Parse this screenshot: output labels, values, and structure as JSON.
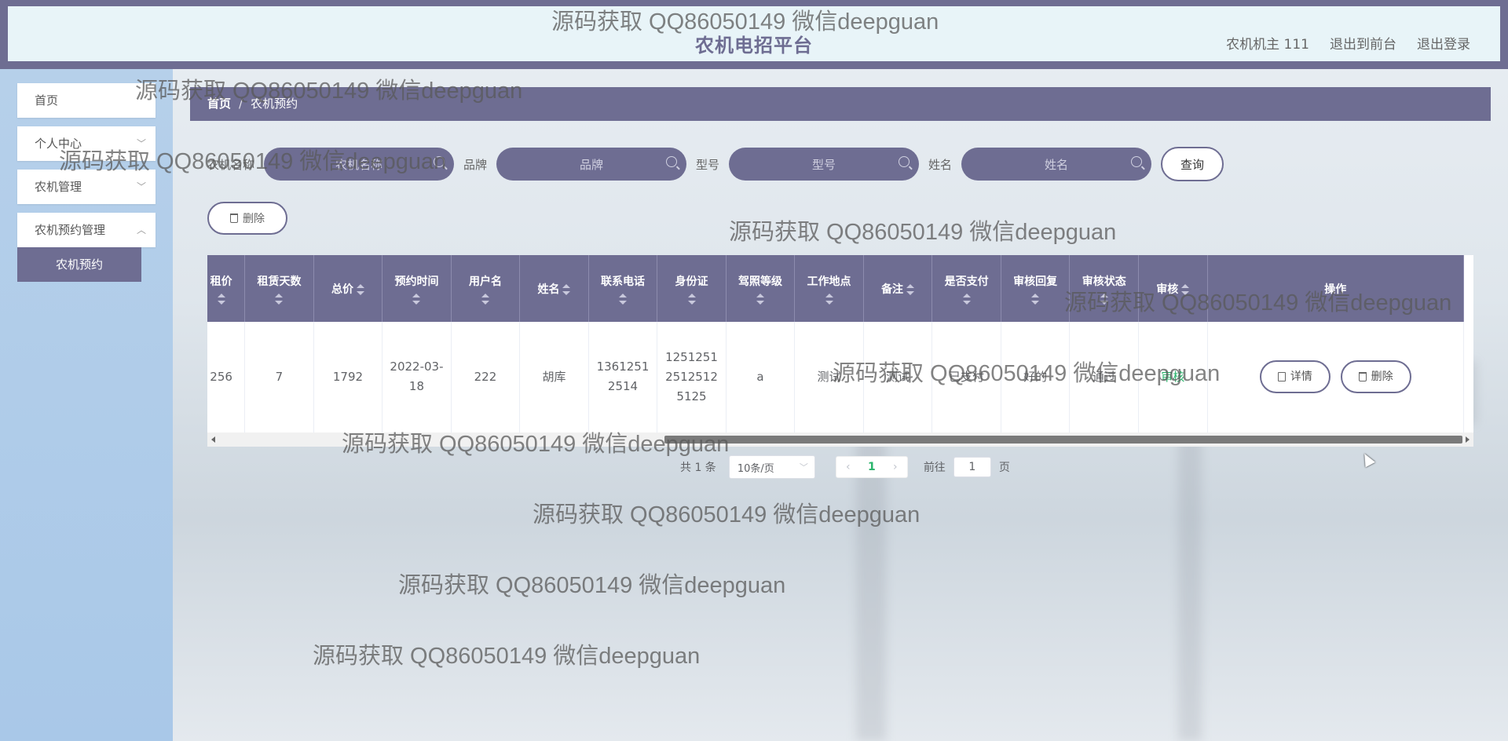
{
  "header": {
    "site_title": "农机电招平台",
    "user_label": "农机机主 111",
    "back_to_front": "退出到前台",
    "logout": "退出登录"
  },
  "sidebar": {
    "items": [
      {
        "label": "首页"
      },
      {
        "label": "个人中心"
      },
      {
        "label": "农机管理"
      },
      {
        "label": "农机预约管理"
      }
    ],
    "active_sub": "农机预约"
  },
  "breadcrumb": {
    "home": "首页",
    "sep": "/",
    "current": "农机预约"
  },
  "search": {
    "fields": [
      {
        "label": "农机名称",
        "placeholder": "农机名称"
      },
      {
        "label": "品牌",
        "placeholder": "品牌"
      },
      {
        "label": "型号",
        "placeholder": "型号"
      },
      {
        "label": "姓名",
        "placeholder": "姓名"
      }
    ],
    "query_button": "查询"
  },
  "toolbar": {
    "delete_label": "删除"
  },
  "table": {
    "columns": [
      "租价",
      "租赁天数",
      "总价",
      "预约时间",
      "用户名",
      "姓名",
      "联系电话",
      "身份证",
      "驾照等级",
      "工作地点",
      "备注",
      "是否支付",
      "审核回复",
      "审核状态",
      "审核",
      "操作"
    ],
    "rows": [
      {
        "cells": [
          "256",
          "7",
          "1792",
          "2022-03-18",
          "222",
          "胡库",
          "13612512514",
          "125125125125125125",
          "a",
          "测试",
          "测试",
          "已支付",
          "好的",
          "通过",
          "审核"
        ],
        "detail_label": "详情",
        "delete_label": "删除"
      }
    ]
  },
  "pagination": {
    "total": "共 1 条",
    "page_size": "10条/页",
    "current_page": "1",
    "goto_prefix": "前往",
    "goto_value": "1",
    "goto_suffix": "页"
  },
  "watermark": "源码获取 QQ86050149 微信deepguan",
  "colors": {
    "primary": "#6e6d92",
    "sidebar": "#b6d0ea",
    "success": "#29b46b"
  }
}
